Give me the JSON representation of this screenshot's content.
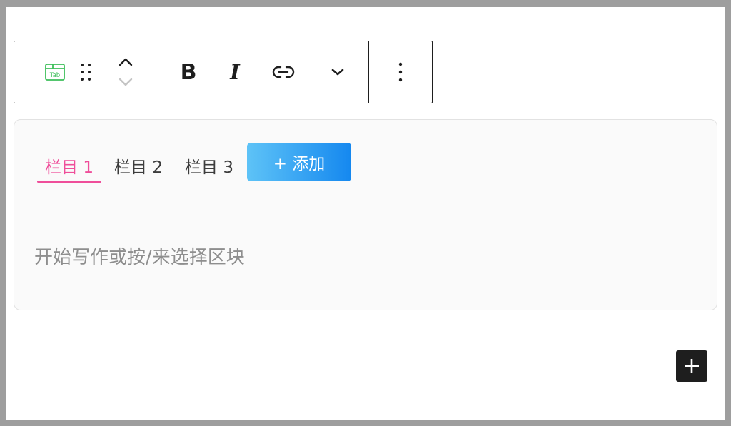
{
  "toolbar": {
    "block_icon_label": "Tab",
    "bold_label": "B",
    "italic_label": "I"
  },
  "tabs": {
    "items": [
      {
        "label": "栏目 1",
        "active": true
      },
      {
        "label": "栏目 2",
        "active": false
      },
      {
        "label": "栏目 3",
        "active": false
      }
    ],
    "add_label": "+ 添加",
    "active_color": "#ef4e9a",
    "add_gradient": [
      "#5ec3f7",
      "#1588ef"
    ]
  },
  "editor": {
    "placeholder": "开始写作或按/来选择区块"
  },
  "colors": {
    "block_icon": "#3dbf5a",
    "toolbar_border": "#1e1e1e",
    "inserter_bg": "#1e1e1e"
  }
}
